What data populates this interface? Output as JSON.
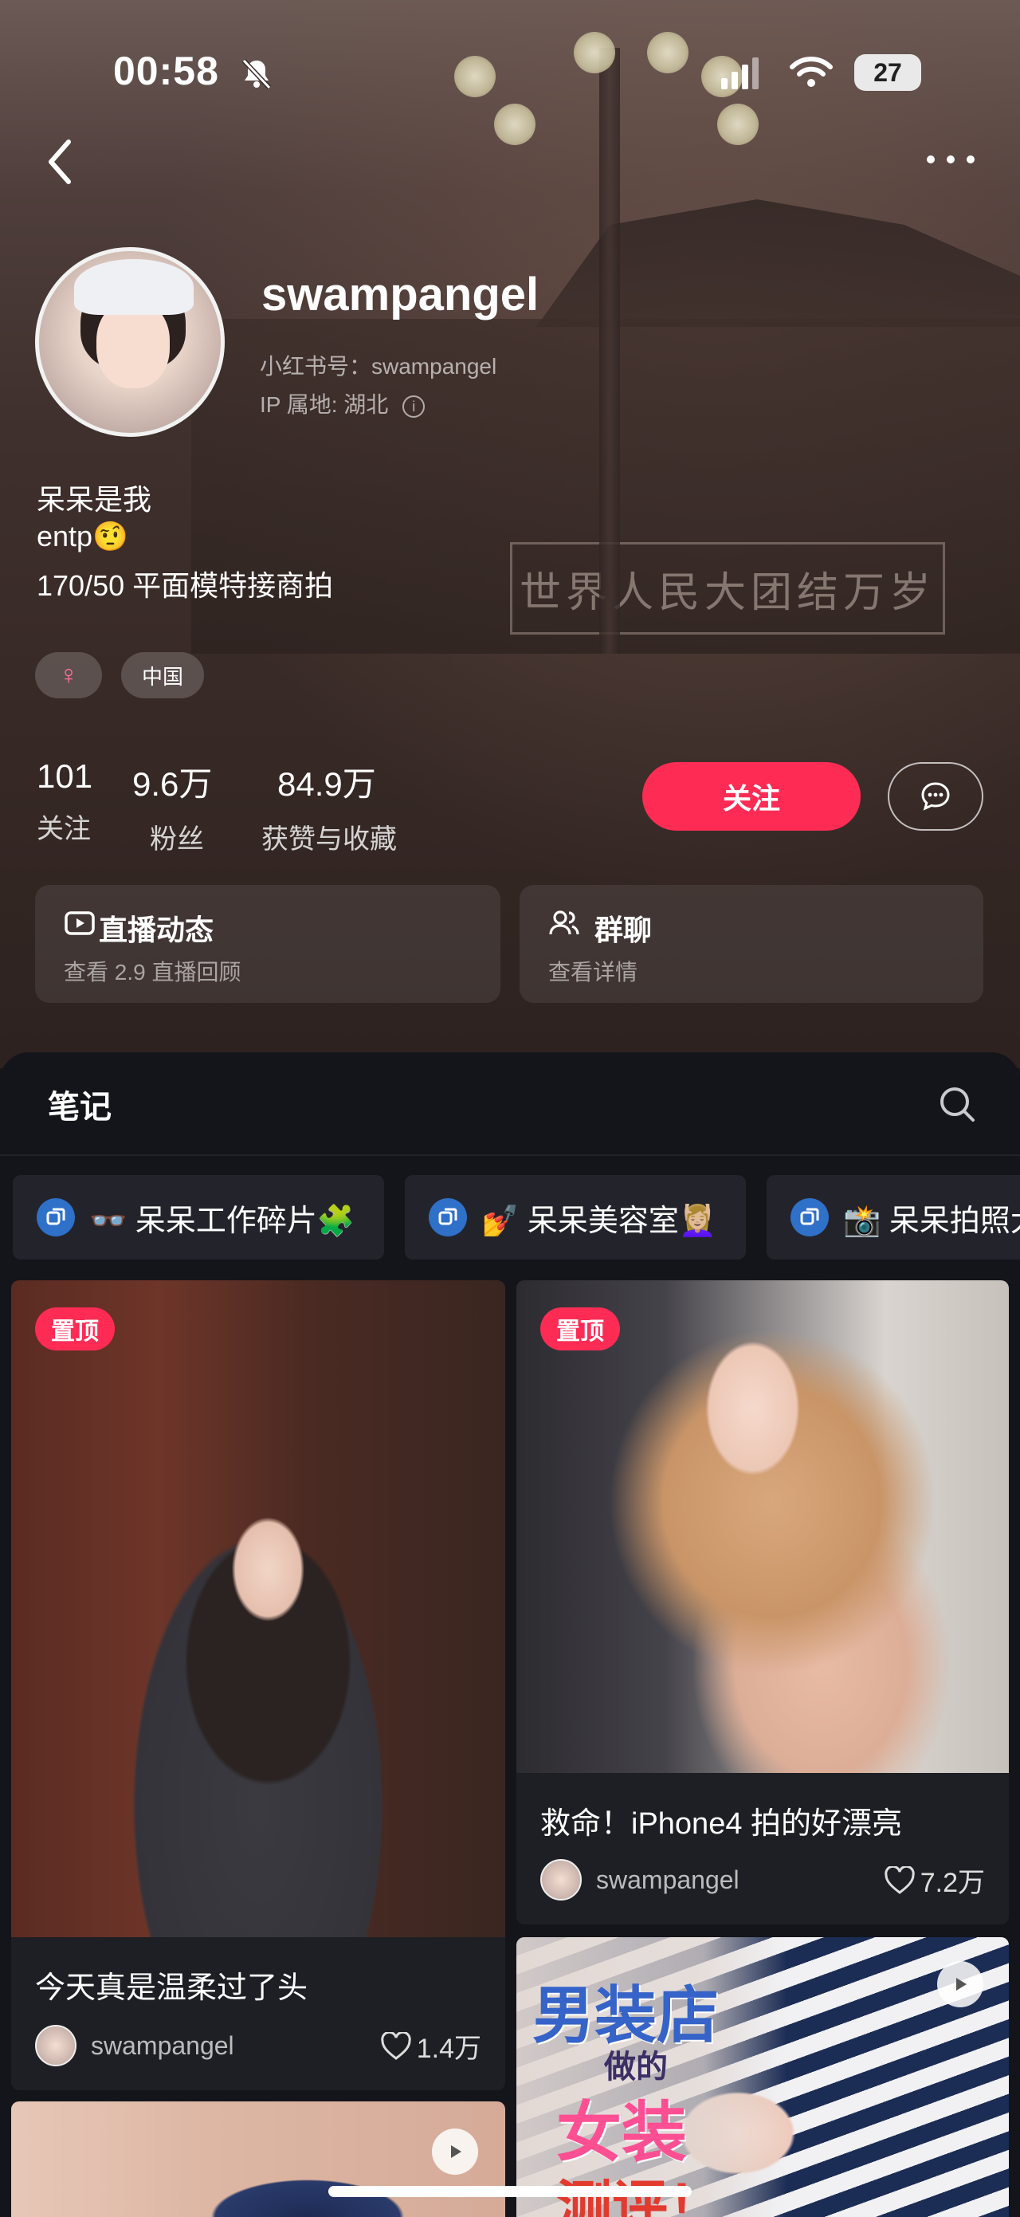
{
  "status_bar": {
    "time": "00:58",
    "battery": "27"
  },
  "profile": {
    "username": "swampangel",
    "red_id": "小红书号：swampangel",
    "ip": "IP 属地: 湖北",
    "bio": [
      "呆呆是我",
      "entp🤨",
      "170/50 平面模特接商拍"
    ],
    "tags": [
      {
        "icon": "♀",
        "color": "#ff6f9c"
      },
      {
        "label": "中国"
      }
    ]
  },
  "background_sign": "世界人民大团结万岁",
  "stats": [
    {
      "value": "101",
      "label": "关注"
    },
    {
      "value": "9.6万",
      "label": "粉丝"
    },
    {
      "value": "84.9万",
      "label": "获赞与收藏"
    }
  ],
  "actions": {
    "follow": "关注"
  },
  "cards": [
    {
      "title": "直播动态",
      "subtitle": "查看 2.9 直播回顾"
    },
    {
      "title": "群聊",
      "subtitle": "查看详情"
    }
  ],
  "notes_tab": {
    "title": "笔记"
  },
  "albums": [
    "👓 呆呆工作碎片🧩",
    "💅 呆呆美容室💆🏼‍♀️",
    "📸 呆呆拍照大"
  ],
  "notes": [
    {
      "pinned": "置顶",
      "title": "今天真是温柔过了头",
      "author": "swampangel",
      "likes": "1.4万"
    },
    {
      "pinned": "置顶",
      "title": "救命！iPhone4 拍的好漂亮",
      "author": "swampangel",
      "likes": "7.2万"
    },
    {
      "overlay": [
        "男装店",
        "做的",
        "女装",
        "测评！"
      ]
    }
  ],
  "colors": {
    "accent": "#fe2c55",
    "panel": "#14151a"
  }
}
